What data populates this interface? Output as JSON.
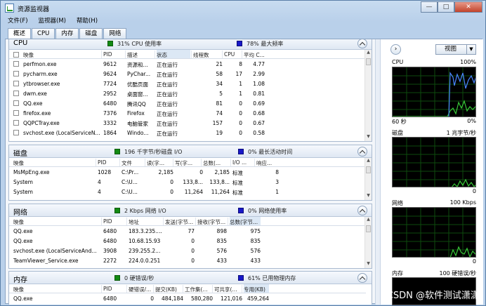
{
  "window": {
    "title": "资源监视器",
    "minimize": "—",
    "maximize": "□",
    "close": "✕"
  },
  "menu": [
    "文件(F)",
    "监视器(M)",
    "帮助(H)"
  ],
  "tabs": [
    "概述",
    "CPU",
    "内存",
    "磁盘",
    "网络"
  ],
  "cpu": {
    "title": "CPU",
    "usage": "31% CPU 使用率",
    "freq": "78% 最大频率",
    "headers": [
      "映像",
      "PID",
      "描述",
      "状态",
      "线程数",
      "CPU",
      "平均 C..."
    ],
    "rows": [
      [
        "perfmon.exe",
        "9612",
        "资源和...",
        "正在运行",
        "21",
        "8",
        "4.77"
      ],
      [
        "pycharm.exe",
        "9624",
        "PyChar...",
        "正在运行",
        "58",
        "17",
        "2.99"
      ],
      [
        "ytbrowser.exe",
        "7724",
        "优酷页面",
        "正在运行",
        "34",
        "1",
        "1.08"
      ],
      [
        "dwm.exe",
        "2952",
        "桌面窗...",
        "正在运行",
        "5",
        "1",
        "0.81"
      ],
      [
        "QQ.exe",
        "6480",
        "腾讯QQ",
        "正在运行",
        "81",
        "0",
        "0.69"
      ],
      [
        "firefox.exe",
        "7376",
        "Firefox",
        "正在运行",
        "74",
        "0",
        "0.68"
      ],
      [
        "QQPCTray.exe",
        "3332",
        "电脑管家",
        "正在运行",
        "157",
        "0",
        "0.67"
      ],
      [
        "svchost.exe (LocalServiceN...",
        "1864",
        "Windo...",
        "正在运行",
        "19",
        "0",
        "0.58"
      ]
    ]
  },
  "disk": {
    "title": "磁盘",
    "io": "196 千字节/秒磁盘 I/O",
    "active": "0% 最长活动时间",
    "headers": [
      "映像",
      "PID",
      "文件",
      "读(字...",
      "写(字...",
      "总数(...",
      "I/O ...",
      "响应..."
    ],
    "rows": [
      [
        "MsMpEng.exe",
        "1028",
        "C:\\Pr...",
        "2,185",
        "0",
        "2,185",
        "标准",
        "8"
      ],
      [
        "System",
        "4",
        "C:\\U...",
        "0",
        "133,8...",
        "133,8...",
        "标准",
        "3"
      ],
      [
        "System",
        "4",
        "C:\\U...",
        "0",
        "11,264",
        "11,264",
        "标准",
        "1"
      ]
    ]
  },
  "network": {
    "title": "网络",
    "io": "2 Kbps 网络 I/O",
    "util": "0% 网络使用率",
    "headers": [
      "映像",
      "PID",
      "地址",
      "发送(字节...",
      "接收(字节...",
      "总数(字节..."
    ],
    "rows": [
      [
        "QQ.exe",
        "6480",
        "183.3.235....",
        "77",
        "898",
        "975"
      ],
      [
        "QQ.exe",
        "6480",
        "10.68.15.93",
        "0",
        "835",
        "835"
      ],
      [
        "svchost.exe (LocalServiceAnd...",
        "3908",
        "239.255.2...",
        "0",
        "576",
        "576"
      ],
      [
        "TeamViewer_Service.exe",
        "2272",
        "224.0.0.251",
        "0",
        "433",
        "433"
      ]
    ]
  },
  "memory": {
    "title": "内存",
    "faults": "0 硬错误/秒",
    "used": "61% 已用物理内存",
    "headers": [
      "映像",
      "PID",
      "硬错误/...",
      "提交(KB)",
      "工作集(...",
      "可共享(...",
      "专用(KB)"
    ],
    "rows": [
      [
        "QQ.exe",
        "6480",
        "0",
        "484,184",
        "580,280",
        "121,016",
        "459,264"
      ]
    ]
  },
  "sidepanel": {
    "view_label": "视图",
    "graphs": [
      {
        "name": "CPU",
        "value": "100%",
        "foot_left": "60 秒",
        "foot_right": "0%"
      },
      {
        "name": "磁盘",
        "value": "1 兆字节/秒",
        "foot_right": "0"
      },
      {
        "name": "网络",
        "value": "100 Kbps",
        "foot_right": "0"
      },
      {
        "name": "内存",
        "value": "100 硬错误/秒"
      }
    ]
  },
  "watermark": "CSDN @软件测试潇潇"
}
